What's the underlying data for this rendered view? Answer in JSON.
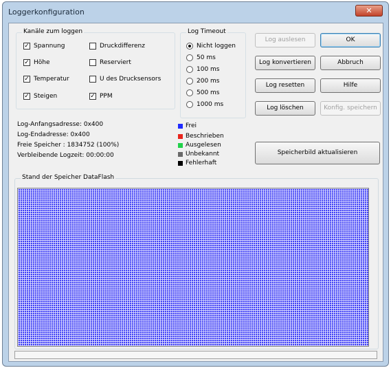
{
  "window": {
    "title": "Loggerkonfiguration",
    "close_symbol": "✕"
  },
  "channels": {
    "title": "Kanäle zum loggen",
    "items": [
      {
        "label": "Spannung",
        "checked": true
      },
      {
        "label": "Druckdifferenz",
        "checked": false
      },
      {
        "label": "Höhe",
        "checked": true
      },
      {
        "label": "Reserviert",
        "checked": false
      },
      {
        "label": "Temperatur",
        "checked": true
      },
      {
        "label": "U des Drucksensors",
        "checked": false
      },
      {
        "label": "Steigen",
        "checked": true
      },
      {
        "label": "PPM",
        "checked": true
      }
    ]
  },
  "timeout": {
    "title": "Log Timeout",
    "options": [
      "Nicht loggen",
      "50 ms",
      "100 ms",
      "200 ms",
      "500 ms",
      "1000 ms"
    ],
    "selected": "Nicht loggen"
  },
  "buttons": {
    "log_auslesen": "Log auslesen",
    "ok": "OK",
    "log_konvertieren": "Log konvertieren",
    "abbruch": "Abbruch",
    "log_resetten": "Log resetten",
    "hilfe": "Hilfe",
    "log_loeschen": "Log löschen",
    "konfig_speichern": "Konfig. speichern",
    "speicherbild": "Speicherbild aktualisieren"
  },
  "info": {
    "anfang": "Log-Anfangsadresse: 0x400",
    "ende": "Log-Endadresse: 0x400",
    "frei": "Freie Speicher : 1834752 (100%)",
    "logzeit": "Verbleibende Logzeit: 00:00:00"
  },
  "legend": [
    {
      "label": "Frei",
      "color": "#1f2bff"
    },
    {
      "label": "Beschrieben",
      "color": "#e8241c"
    },
    {
      "label": "Ausgelesen",
      "color": "#21d14a"
    },
    {
      "label": "Unbekannt",
      "color": "#6a6a6a"
    },
    {
      "label": "Fehlerhaft",
      "color": "#000000"
    }
  ],
  "memory": {
    "title": "Stand der Speicher DataFlash"
  }
}
